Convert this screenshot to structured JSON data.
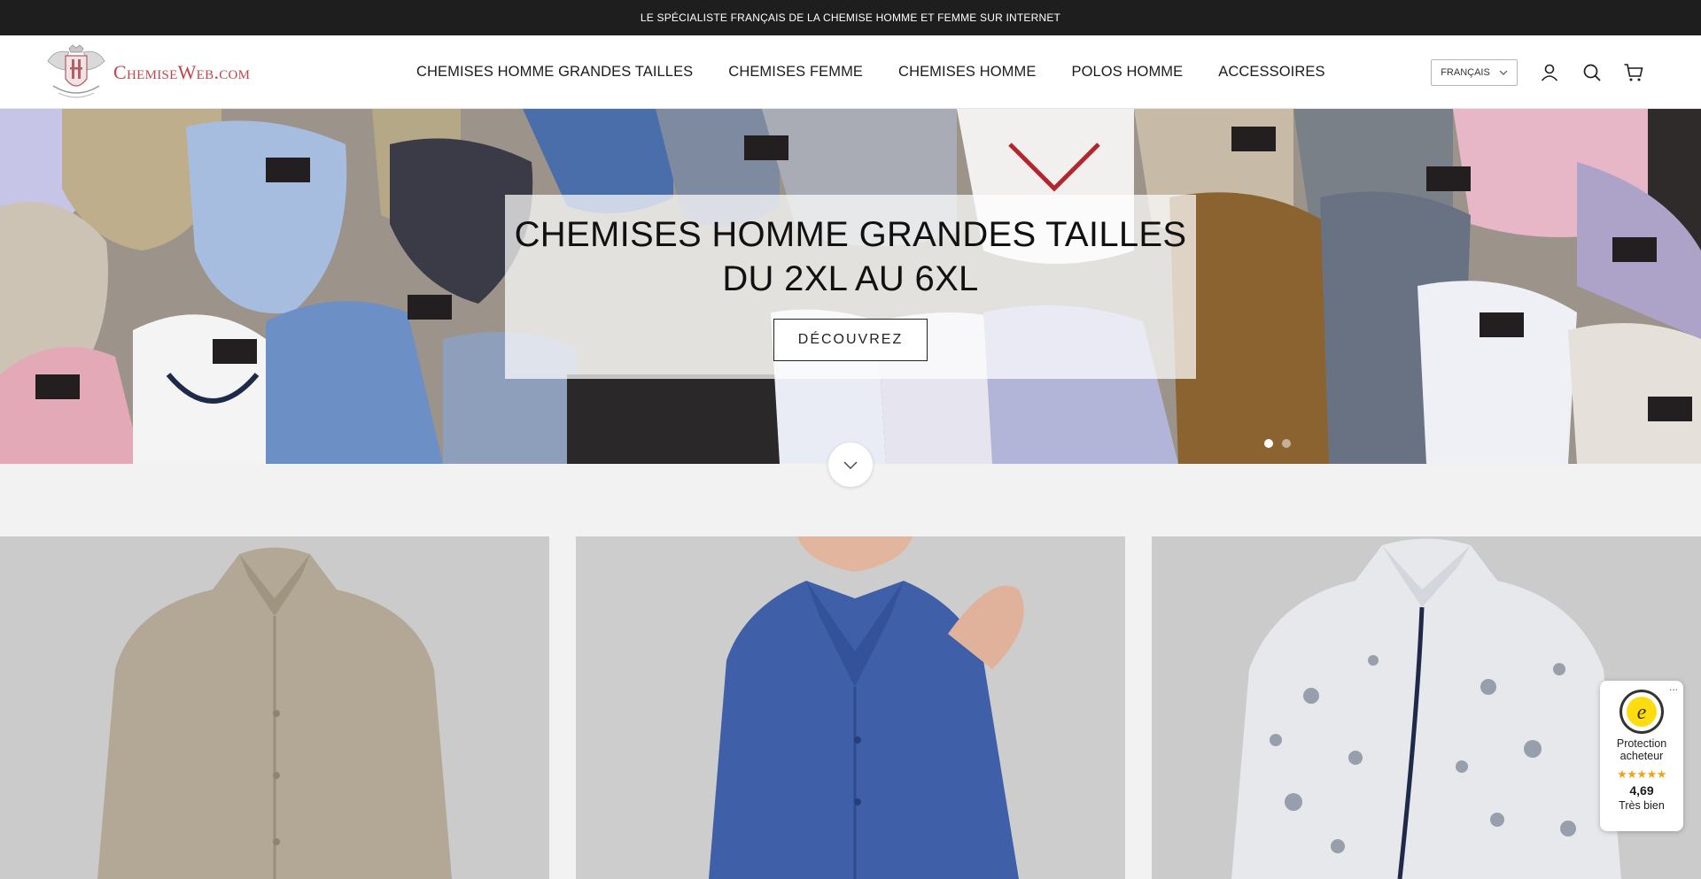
{
  "announcement": "LE SPÉCIALISTE FRANÇAIS DE LA CHEMISE HOMME ET FEMME SUR INTERNET",
  "header": {
    "logo_text": "ChemiseWeb.com",
    "nav": [
      "CHEMISES HOMME GRANDES TAILLES",
      "CHEMISES FEMME",
      "CHEMISES HOMME",
      "POLOS HOMME",
      "ACCESSOIRES"
    ],
    "language": "FRANÇAIS",
    "icons": [
      "account-icon",
      "search-icon",
      "cart-icon"
    ]
  },
  "hero": {
    "title_line1": "CHEMISES HOMME GRANDES TAILLES",
    "title_line2": "DU 2XL AU 6XL",
    "button": "DÉCOUVREZ",
    "slides_total": 2,
    "active_slide": 1
  },
  "collections": [
    {
      "name": "beige-men-shirt",
      "color": "#b5aa98"
    },
    {
      "name": "blue-women-shirt",
      "color": "#3d5ea8"
    },
    {
      "name": "floral-men-shirt",
      "color": "#e4e6ea"
    }
  ],
  "trusted_shops": {
    "more": "...",
    "label_line1": "Protection",
    "label_line2": "acheteur",
    "stars": "★★★★★",
    "score": "4,69",
    "grade": "Très bien"
  },
  "colors": {
    "announcement_bg": "#1e1e1e",
    "logo_red": "#c0444c",
    "star_orange": "#f3a11a"
  }
}
